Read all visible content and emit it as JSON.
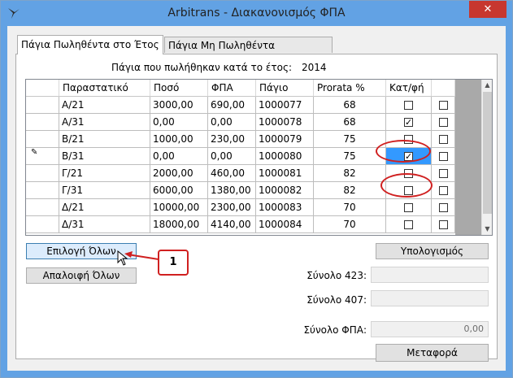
{
  "window": {
    "title": "Arbitrans - Διακανονισμός ΦΠΑ",
    "close_glyph": "✕"
  },
  "tabs": [
    {
      "label": "Πάγια Πωληθέντα στο Έτος",
      "active": true
    },
    {
      "label": "Πάγια Μη Πωληθέντα Πενταετίας",
      "active": false
    }
  ],
  "caption": {
    "text": "Πάγια που πωλήθηκαν κατά το έτος:",
    "year": "2014"
  },
  "table": {
    "columns": [
      "Παραστατικό",
      "Ποσό",
      "ΦΠΑ",
      "Πάγιο",
      "Prorata %",
      "Κατ/φή"
    ],
    "rows": [
      {
        "doc": "Α/21",
        "amount": "3000,00",
        "vat": "690,00",
        "asset": "1000077",
        "prorata": "68",
        "chk1": false,
        "chk2": false,
        "marker": ""
      },
      {
        "doc": "Α/31",
        "amount": "0,00",
        "vat": "0,00",
        "asset": "1000078",
        "prorata": "68",
        "chk1": true,
        "chk2": false,
        "marker": ""
      },
      {
        "doc": "Β/21",
        "amount": "1000,00",
        "vat": "230,00",
        "asset": "1000079",
        "prorata": "75",
        "chk1": false,
        "chk2": false,
        "marker": ""
      },
      {
        "doc": "Β/31",
        "amount": "0,00",
        "vat": "0,00",
        "asset": "1000080",
        "prorata": "75",
        "chk1": true,
        "chk2": false,
        "marker": "✎"
      },
      {
        "doc": "Γ/21",
        "amount": "2000,00",
        "vat": "460,00",
        "asset": "1000081",
        "prorata": "82",
        "chk1": false,
        "chk2": false,
        "marker": ""
      },
      {
        "doc": "Γ/31",
        "amount": "6000,00",
        "vat": "1380,00",
        "asset": "1000082",
        "prorata": "82",
        "chk1": false,
        "chk2": false,
        "marker": ""
      },
      {
        "doc": "Δ/21",
        "amount": "10000,00",
        "vat": "2300,00",
        "asset": "1000083",
        "prorata": "70",
        "chk1": false,
        "chk2": false,
        "marker": ""
      },
      {
        "doc": "Δ/31",
        "amount": "18000,00",
        "vat": "4140,00",
        "asset": "1000084",
        "prorata": "70",
        "chk1": false,
        "chk2": false,
        "marker": ""
      }
    ]
  },
  "buttons": {
    "select_all": "Επιλογή Όλων",
    "deselect_all": "Απαλοιφή Όλων",
    "calculate": "Υπολογισμός",
    "transfer": "Μεταφορά"
  },
  "totals": {
    "sum423_label": "Σύνολο 423:",
    "sum423_value": "",
    "sum407_label": "Σύνολο 407:",
    "sum407_value": "",
    "vat_total_label": "Σύνολο ΦΠΑ:",
    "vat_total_value": "0,00"
  },
  "annotation": {
    "callout_number": "1"
  },
  "colors": {
    "titlebar": "#62a2e4",
    "selection": "#3399ff",
    "annotation": "#d02020"
  }
}
